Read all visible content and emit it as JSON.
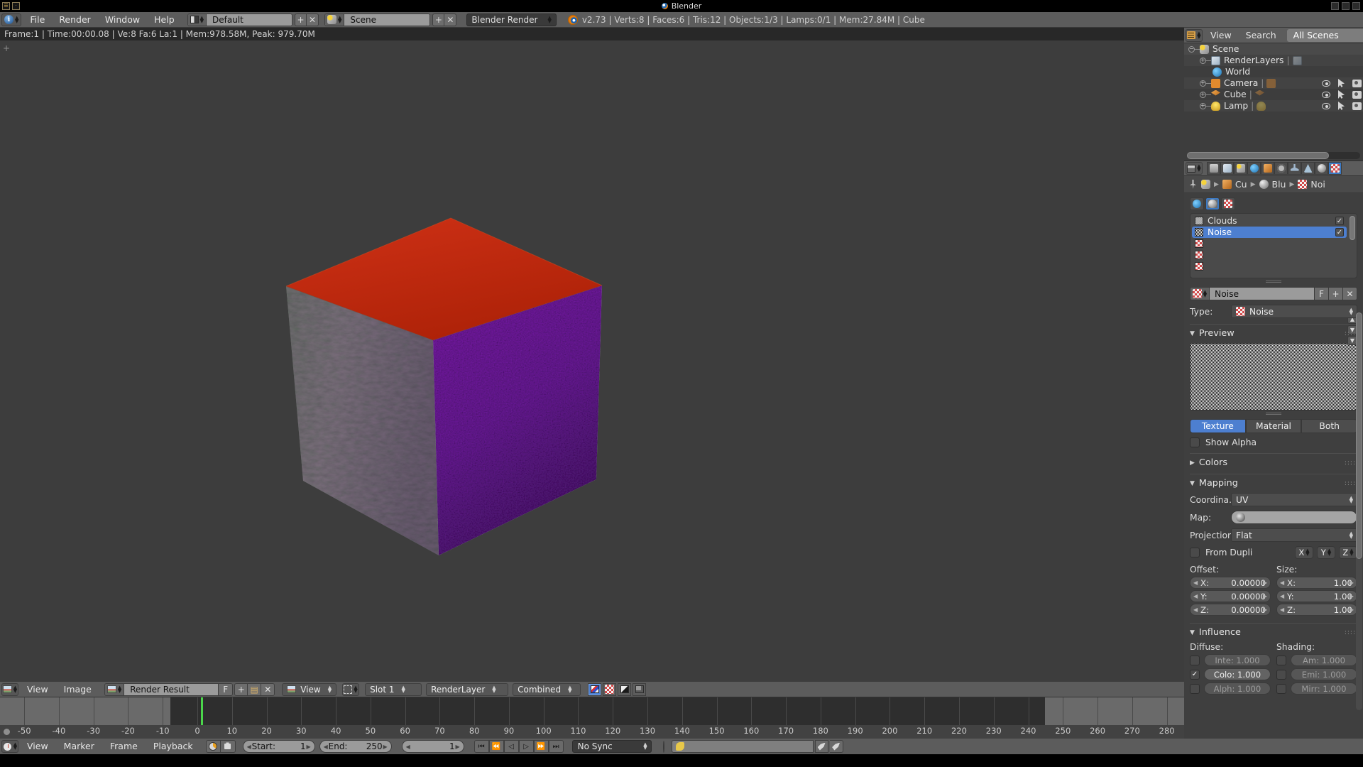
{
  "window": {
    "title": "Blender",
    "app_icon": "blender-logo-icon",
    "min_label": "–",
    "max_label": "☐",
    "close_label": "✕"
  },
  "info_header": {
    "editor_icon": "info-editor-icon",
    "menus": [
      "File",
      "Render",
      "Window",
      "Help"
    ],
    "screen_layout": {
      "icon": "screen-layout-icon",
      "value": "Default",
      "add": "+",
      "remove": "✕"
    },
    "scene_select": {
      "icon": "scene-icon",
      "value": "Scene",
      "add": "+",
      "remove": "✕"
    },
    "render_engine": "Blender Render",
    "stats": "v2.73 | Verts:8 | Faces:6 | Tris:12 | Objects:1/3 | Lamps:0/1 | Mem:27.84M | Cube"
  },
  "viewport": {
    "render_info": "Frame:1 | Time:00:00.08 | Ve:8 Fa:6 La:1 | Mem:978.58M, Peak: 979.70M"
  },
  "outliner": {
    "editor_icon": "outliner-editor-icon",
    "menus": [
      "View",
      "Search"
    ],
    "display_mode": "All Scenes",
    "rows": [
      {
        "label": "Scene",
        "icon": "scene-icon",
        "indent": 0,
        "expander": "−",
        "selected": true,
        "has_controls": false,
        "ghost_icon": null
      },
      {
        "label": "RenderLayers",
        "icon": "renderlayer-icon",
        "indent": 1,
        "expander": "+",
        "selected": false,
        "has_controls": false,
        "ghost_icon": "renderlayer-icon"
      },
      {
        "label": "World",
        "icon": "world-icon",
        "indent": 1,
        "expander": "",
        "selected": false,
        "has_controls": false,
        "ghost_icon": null
      },
      {
        "label": "Camera",
        "icon": "camera-icon",
        "indent": 1,
        "expander": "+",
        "selected": false,
        "has_controls": true,
        "ghost_icon": "camera-icon"
      },
      {
        "label": "Cube",
        "icon": "mesh-icon",
        "indent": 1,
        "expander": "+",
        "selected": false,
        "has_controls": true,
        "ghost_icon": "mesh-icon"
      },
      {
        "label": "Lamp",
        "icon": "lamp-icon",
        "indent": 1,
        "expander": "+",
        "selected": false,
        "has_controls": true,
        "ghost_icon": "lamp-icon"
      }
    ],
    "row_icons": {
      "visibility": "eye-icon",
      "selectability": "cursor-icon",
      "renderability": "camera-render-icon"
    }
  },
  "properties": {
    "editor_icon": "properties-editor-icon",
    "tabs": [
      {
        "name": "render",
        "icon": "camera-render-icon",
        "active": false
      },
      {
        "name": "render-layers",
        "icon": "render-layers-icon",
        "active": false
      },
      {
        "name": "scene",
        "icon": "scene-icon",
        "active": false
      },
      {
        "name": "world",
        "icon": "world-icon",
        "active": false
      },
      {
        "name": "object",
        "icon": "object-cube-icon",
        "active": false
      },
      {
        "name": "constraints",
        "icon": "constraint-chain-icon",
        "active": false
      },
      {
        "name": "modifiers",
        "icon": "wrench-icon",
        "active": false
      },
      {
        "name": "object-data",
        "icon": "mesh-data-icon",
        "active": false
      },
      {
        "name": "material",
        "icon": "material-sphere-icon",
        "active": false
      },
      {
        "name": "texture",
        "icon": "texture-checker-icon",
        "active": true
      }
    ],
    "breadcrumb": {
      "pin_icon": "pin-icon",
      "items": [
        {
          "icon": "scene-icon",
          "label": ""
        },
        {
          "icon": "object-cube-icon",
          "label": "Cu"
        },
        {
          "icon": "material-sphere-icon",
          "label": "Blu"
        },
        {
          "icon": "texture-checker-icon",
          "label": "Noi"
        }
      ]
    },
    "context_tabs": [
      {
        "name": "world-texture-context",
        "icon": "world-icon",
        "active": false
      },
      {
        "name": "material-texture-context",
        "icon": "material-sphere-icon",
        "active": true
      },
      {
        "name": "brush-texture-context",
        "icon": "texture-checker-icon",
        "active": false
      }
    ],
    "texture_slots": [
      {
        "label": "Clouds",
        "thumb": "clouds-thumb",
        "enabled": true,
        "selected": false
      },
      {
        "label": "Noise",
        "thumb": "noise-thumb",
        "enabled": true,
        "selected": true
      },
      {
        "label": "",
        "thumb": "empty-checker-thumb",
        "enabled": false,
        "selected": false
      },
      {
        "label": "",
        "thumb": "empty-checker-thumb",
        "enabled": false,
        "selected": false
      },
      {
        "label": "",
        "thumb": "empty-checker-thumb",
        "enabled": false,
        "selected": false
      }
    ],
    "slot_side_buttons": [
      "▲",
      "▼",
      "▼"
    ],
    "datablock": {
      "icon": "texture-checker-icon",
      "name": "Noise",
      "fake_user": "F",
      "new": "+",
      "unlink": "✕"
    },
    "type_row": {
      "label": "Type:",
      "icon": "texture-checker-icon",
      "value": "Noise"
    },
    "preview_panel": {
      "title": "Preview",
      "expanded": true
    },
    "preview_modes": [
      {
        "label": "Texture",
        "active": true
      },
      {
        "label": "Material",
        "active": false
      },
      {
        "label": "Both",
        "active": false
      }
    ],
    "show_alpha": {
      "label": "Show Alpha",
      "checked": false
    },
    "colors_panel": {
      "title": "Colors",
      "expanded": false
    },
    "mapping_panel": {
      "title": "Mapping",
      "expanded": true,
      "coordinates": {
        "label": "Coordina…",
        "value": "UV"
      },
      "map": {
        "label": "Map:",
        "icon": "uv-map-icon",
        "value": ""
      },
      "projection": {
        "label": "Projection:",
        "value": "Flat"
      },
      "from_dupli": {
        "label": "From Dupli",
        "checked": false
      },
      "axis_buttons": [
        "X",
        "Y",
        "Z"
      ],
      "offset": {
        "title": "Offset:",
        "fields": [
          {
            "key": "X:",
            "value": "0.00000"
          },
          {
            "key": "Y:",
            "value": "0.00000"
          },
          {
            "key": "Z:",
            "value": "0.00000"
          }
        ]
      },
      "size": {
        "title": "Size:",
        "fields": [
          {
            "key": "X:",
            "value": "1.00"
          },
          {
            "key": "Y:",
            "value": "1.00"
          },
          {
            "key": "Z:",
            "value": "1.00"
          }
        ]
      }
    },
    "influence_panel": {
      "title": "Influence",
      "expanded": true,
      "diffuse": {
        "title": "Diffuse:",
        "rows": [
          {
            "label": "Inte: 1.000",
            "checked": false
          },
          {
            "label": "Colo: 1.000",
            "checked": true
          },
          {
            "label": "Alph: 1.000",
            "checked": false
          }
        ]
      },
      "shading": {
        "title": "Shading:",
        "rows": [
          {
            "label": "Am: 1.000",
            "checked": false
          },
          {
            "label": "Emi: 1.000",
            "checked": false
          },
          {
            "label": "Mirr: 1.000",
            "checked": false
          }
        ]
      }
    }
  },
  "image_editor": {
    "editor_icon": "image-editor-icon",
    "menus": [
      "View",
      "Image"
    ],
    "image_datablock": {
      "icon": "image-icon",
      "name": "Render Result",
      "fake_user": "F",
      "new": "+",
      "open": "▤",
      "unlink": "✕"
    },
    "view_mode": {
      "icon": "image-icon",
      "value": "View"
    },
    "pivot_icon": "pivot-icon",
    "slot": "Slot 1",
    "render_layer": "RenderLayer",
    "pass": "Combined",
    "channel_buttons": [
      {
        "name": "color-and-alpha",
        "active": true
      },
      {
        "name": "color",
        "active": false
      },
      {
        "name": "alpha",
        "active": false
      },
      {
        "name": "z-buffer",
        "active": false
      }
    ]
  },
  "timeline": {
    "editor_icon": "timeline-editor-icon",
    "menus": [
      "View",
      "Marker",
      "Frame",
      "Playback"
    ],
    "auto_key_icon": "auto-keyframe-icon",
    "lock_icon": "lock-icon",
    "start": {
      "label": "Start:",
      "value": "1"
    },
    "end": {
      "label": "End:",
      "value": "250"
    },
    "current_frame": "1",
    "transport": [
      "⏮",
      "⏪",
      "◁",
      "▷",
      "⏩",
      "⏭"
    ],
    "sync_mode": "No Sync",
    "record_icon": "record-icon",
    "keying_set": {
      "icon": "key-icon",
      "value": ""
    },
    "end_buttons": [
      "key-add-icon",
      "key-remove-icon"
    ],
    "ruler_ticks": [
      {
        "label": "-50",
        "frame": -50
      },
      {
        "label": "-40",
        "frame": -40
      },
      {
        "label": "-30",
        "frame": -30
      },
      {
        "label": "-20",
        "frame": -20
      },
      {
        "label": "-10",
        "frame": -10
      },
      {
        "label": "0",
        "frame": 0
      },
      {
        "label": "10",
        "frame": 10
      },
      {
        "label": "20",
        "frame": 20
      },
      {
        "label": "30",
        "frame": 30
      },
      {
        "label": "40",
        "frame": 40
      },
      {
        "label": "50",
        "frame": 50
      },
      {
        "label": "60",
        "frame": 60
      },
      {
        "label": "70",
        "frame": 70
      },
      {
        "label": "80",
        "frame": 80
      },
      {
        "label": "90",
        "frame": 90
      },
      {
        "label": "100",
        "frame": 100
      },
      {
        "label": "110",
        "frame": 110
      },
      {
        "label": "120",
        "frame": 120
      },
      {
        "label": "130",
        "frame": 130
      },
      {
        "label": "140",
        "frame": 140
      },
      {
        "label": "150",
        "frame": 150
      },
      {
        "label": "160",
        "frame": 160
      },
      {
        "label": "170",
        "frame": 170
      },
      {
        "label": "180",
        "frame": 180
      },
      {
        "label": "190",
        "frame": 190
      },
      {
        "label": "200",
        "frame": 200
      },
      {
        "label": "210",
        "frame": 210
      },
      {
        "label": "220",
        "frame": 220
      },
      {
        "label": "230",
        "frame": 230
      },
      {
        "label": "240",
        "frame": 240
      },
      {
        "label": "250",
        "frame": 250
      },
      {
        "label": "260",
        "frame": 260
      },
      {
        "label": "270",
        "frame": 270
      },
      {
        "label": "280",
        "frame": 280
      }
    ]
  },
  "colors": {
    "accent_blue": "#4d7fd0",
    "header_grey": "#5c5c5c",
    "panel_grey": "#3f3f3f",
    "viewport_grey": "#3d3d3d",
    "cube_top_red": "#c32a12",
    "cube_right_purple": "#6b1e96",
    "playhead_green": "#4bd64b"
  }
}
